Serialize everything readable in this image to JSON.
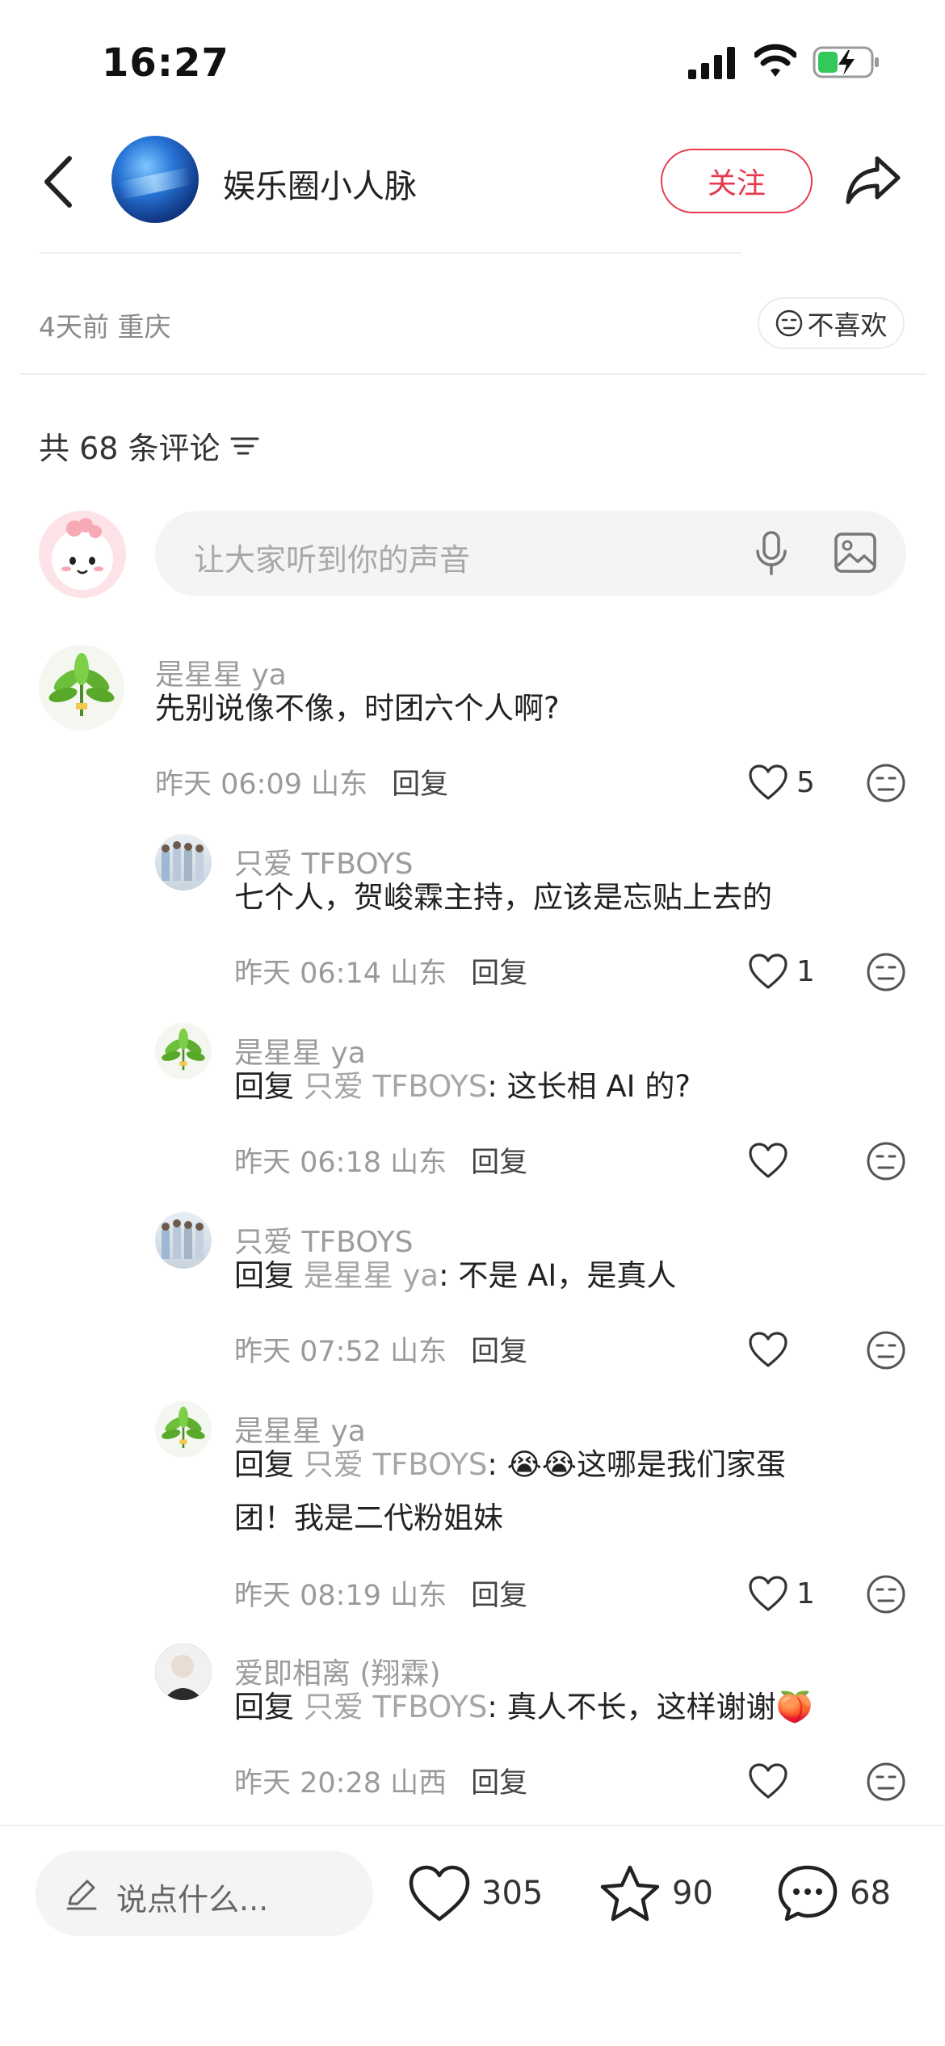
{
  "status_bar": {
    "time": "16:27"
  },
  "header": {
    "author": "娱乐圈小人脉",
    "follow_label": "关注"
  },
  "post": {
    "time_location": "4天前 重庆",
    "dislike_label": "不喜欢"
  },
  "comments_header": {
    "count_label": "共 68 条评论"
  },
  "comment_input": {
    "placeholder": "让大家听到你的声音"
  },
  "comments": [
    {
      "user": "是星星 ya",
      "text": "先别说像不像，时团六个人啊?",
      "time": "昨天 06:09 山东",
      "reply": "回复",
      "likes": "5"
    },
    {
      "user": "只爱 TFBOYS",
      "text": "七个人，贺峻霖主持，应该是忘贴上去的",
      "time": "昨天 06:14 山东",
      "reply": "回复",
      "likes": "1"
    },
    {
      "user": "是星星 ya",
      "prefix": "回复",
      "ref": "只爱 TFBOYS",
      "text": ": 这长相 AI 的?",
      "time": "昨天 06:18 山东",
      "reply": "回复",
      "likes": ""
    },
    {
      "user": "只爱 TFBOYS",
      "prefix": "回复",
      "ref": "是星星 ya",
      "text": ": 不是 AI，是真人",
      "time": "昨天 07:52 山东",
      "reply": "回复",
      "likes": ""
    },
    {
      "user": "是星星 ya",
      "prefix": "回复",
      "ref": "只爱 TFBOYS",
      "text": ": 😭😭这哪是我们家蛋",
      "text2": "团！我是二代粉姐妹",
      "time": "昨天 08:19 山东",
      "reply": "回复",
      "likes": "1"
    },
    {
      "user": "爱即相离 (翔霖)",
      "prefix": "回复",
      "ref": "只爱 TFBOYS",
      "text": ": 真人不长，这样谢谢🍑",
      "time": "昨天 20:28 山西",
      "reply": "回复",
      "likes": ""
    }
  ],
  "bottom_bar": {
    "say_placeholder": "说点什么...",
    "likes": "305",
    "stars": "90",
    "comments": "68"
  },
  "colors": {
    "accent": "#e6394f"
  }
}
